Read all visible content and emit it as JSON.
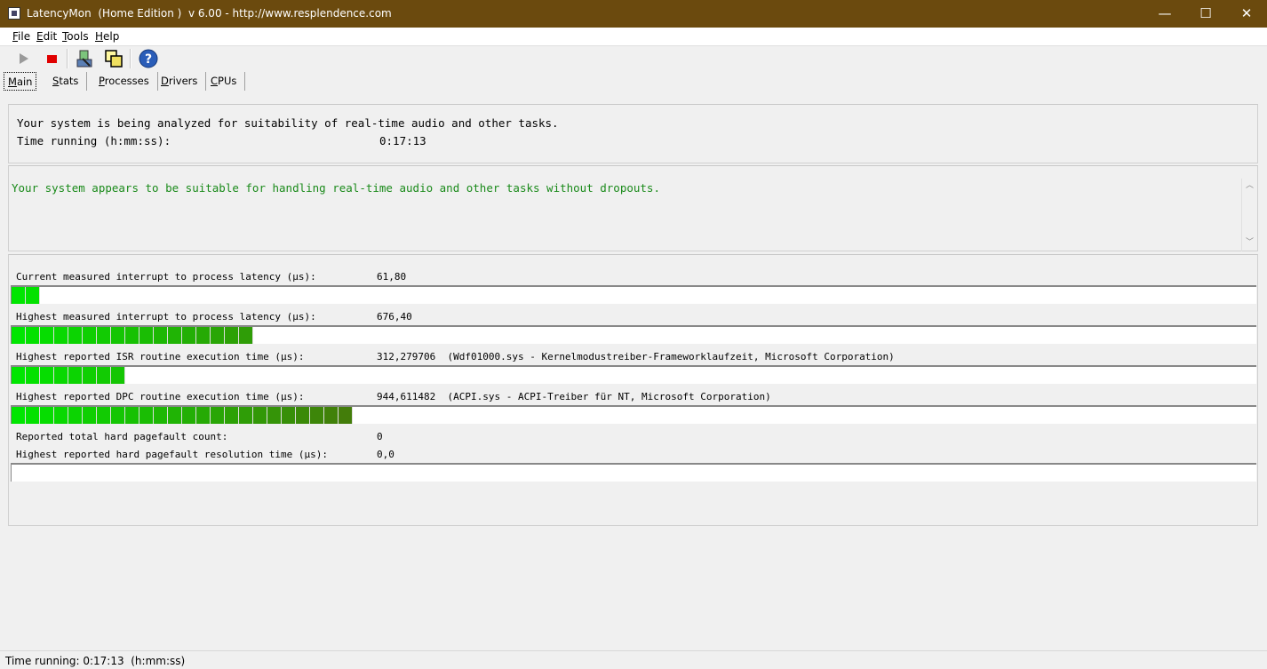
{
  "window": {
    "title": "LatencyMon  (Home Edition )  v 6.00 - http://www.resplendence.com",
    "minimize_symbol": "—",
    "maximize_symbol": "☐",
    "close_symbol": "✕"
  },
  "menu": [
    {
      "key": "F",
      "rest": "ile"
    },
    {
      "key": "E",
      "rest": "dit"
    },
    {
      "key": "T",
      "rest": "ools"
    },
    {
      "key": "H",
      "rest": "elp"
    }
  ],
  "toolbar": {
    "icons": [
      "play-icon",
      "stop-icon",
      "drivers-icon",
      "windows-icon",
      "help-icon"
    ]
  },
  "tabs": [
    {
      "key": "M",
      "rest": "ain",
      "active": true
    },
    {
      "key": "S",
      "rest": "tats",
      "active": false
    },
    {
      "key": "P",
      "rest": "rocesses",
      "active": false
    },
    {
      "key": "D",
      "rest": "rivers",
      "active": false
    },
    {
      "key": "C",
      "rest": "PUs",
      "active": false
    }
  ],
  "analysis": {
    "status_line": "Your system is being analyzed for suitability of real-time audio and other tasks.",
    "time_label": "Time running (h:mm:ss):",
    "time_value": "0:17:13"
  },
  "verdict": {
    "text": "Your system appears to be suitable for handling real-time audio and other tasks without dropouts.",
    "color": "#1a8a1a"
  },
  "metrics": {
    "current_latency": {
      "label": "Current measured interrupt to process latency (µs):",
      "value": "61,80",
      "segments": 2
    },
    "highest_latency": {
      "label": "Highest measured interrupt to process latency (µs):",
      "value": "676,40",
      "segments": 17
    },
    "highest_isr": {
      "label": "Highest reported ISR routine execution time (µs):",
      "value": "312,279706",
      "detail": "(Wdf01000.sys - Kernelmodustreiber-Frameworklaufzeit, Microsoft Corporation)",
      "segments": 8
    },
    "highest_dpc": {
      "label": "Highest reported DPC routine execution time (µs):",
      "value": "944,611482",
      "detail": "(ACPI.sys - ACPI-Treiber für NT, Microsoft Corporation)",
      "segments": 24
    },
    "pagefault_count": {
      "label": "Reported total hard pagefault count:",
      "value": "0"
    },
    "pagefault_time": {
      "label": "Highest reported hard pagefault resolution time (µs):",
      "value": "0,0",
      "segments": 0
    }
  },
  "statusbar": {
    "text": "Time running: 0:17:13  (h:mm:ss)"
  }
}
